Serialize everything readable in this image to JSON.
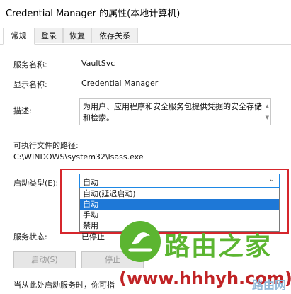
{
  "window": {
    "title": "Credential Manager 的属性(本地计算机)"
  },
  "tabs": [
    {
      "label": "常规"
    },
    {
      "label": "登录"
    },
    {
      "label": "恢复"
    },
    {
      "label": "依存关系"
    }
  ],
  "general": {
    "service_name_label": "服务名称:",
    "service_name_value": "VaultSvc",
    "display_name_label": "显示名称:",
    "display_name_value": "Credential Manager",
    "description_label": "描述:",
    "description_value": "为用户、应用程序和安全服务包提供凭据的安全存储和检索。",
    "exe_path_label": "可执行文件的路径:",
    "exe_path_value": "C:\\WINDOWS\\system32\\lsass.exe",
    "startup_type_label": "启动类型(E):",
    "startup_type_value": "自动",
    "startup_options": [
      "自动(延迟启动)",
      "自动",
      "手动",
      "禁用"
    ],
    "selected_option_index": 1,
    "service_status_label": "服务状态:",
    "service_status_value": "已停止",
    "buttons": {
      "start": "启动(S)",
      "stop": "停止"
    },
    "footer_text": "当从此处启动服务时，你可指"
  },
  "watermark": {
    "brand": "路由之家",
    "url": "(www.hhhyh.com)",
    "small": "路由网"
  },
  "colors": {
    "accent": "#1e78d7",
    "highlight_border": "#d6262c",
    "watermark_green": "#5cb531",
    "watermark_red": "#c02325"
  }
}
